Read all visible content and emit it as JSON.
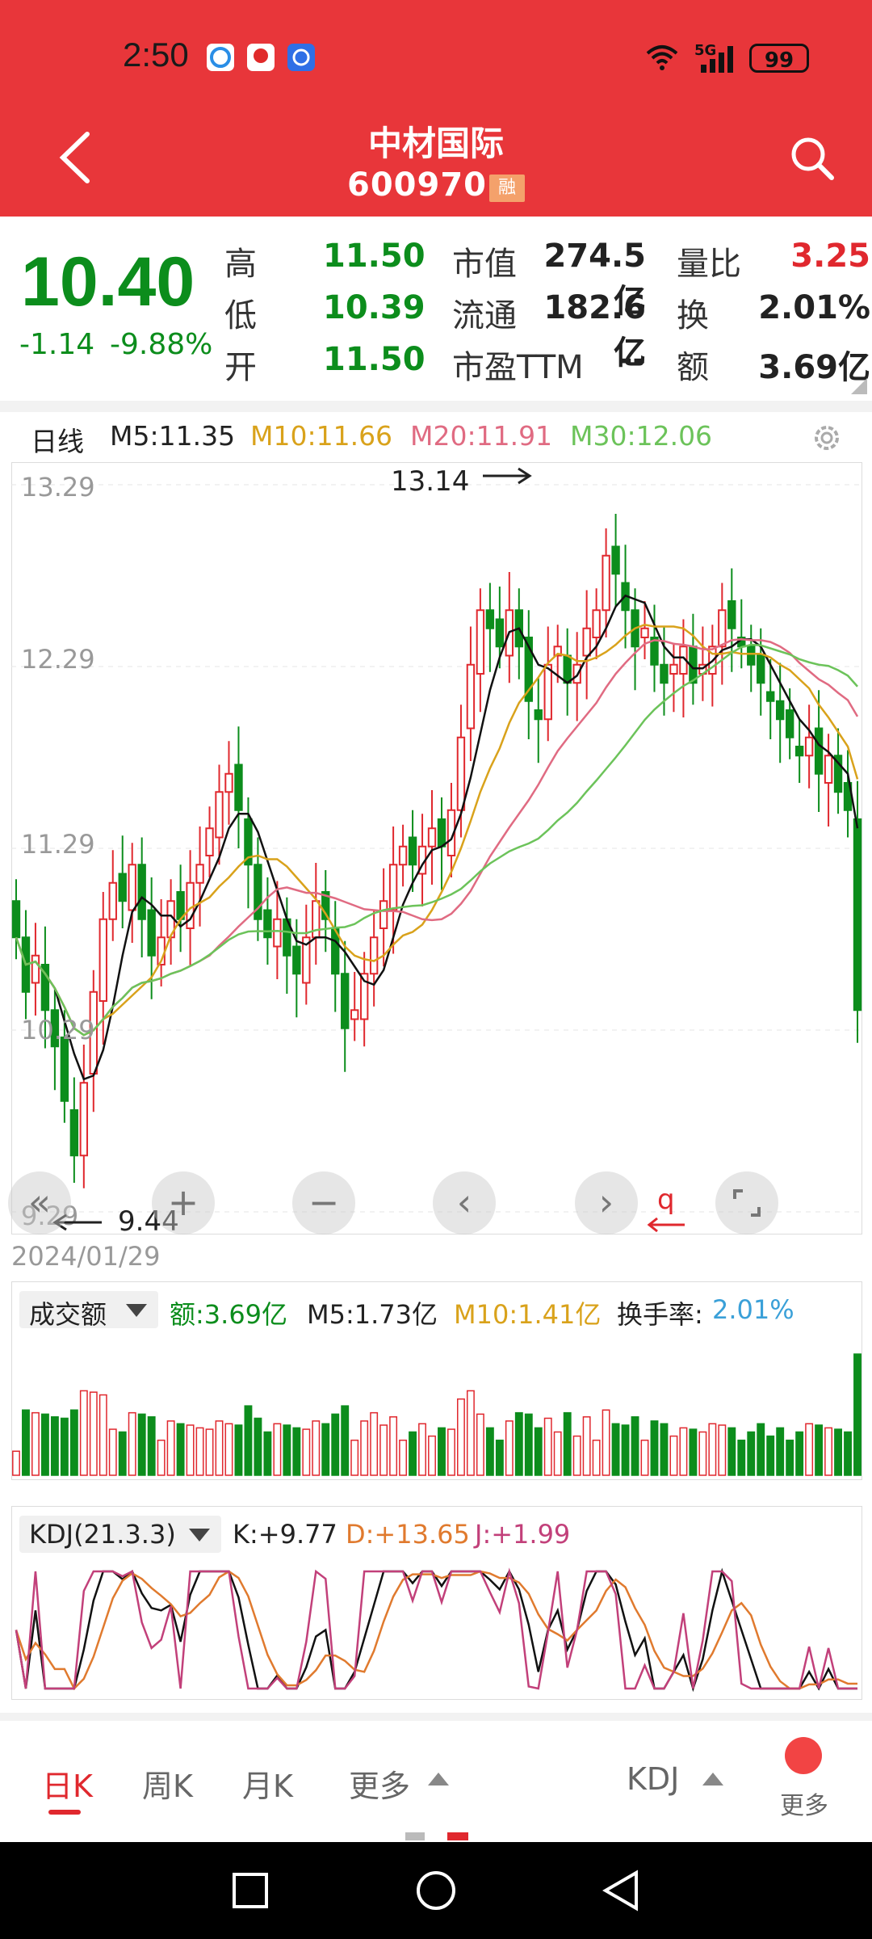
{
  "status": {
    "time": "2:50",
    "battery": "99",
    "network": "5G"
  },
  "header": {
    "name": "中材国际",
    "code": "600970",
    "badge": "融"
  },
  "quote": {
    "price": "10.40",
    "change": "-1.14",
    "change_pct": "-9.88%",
    "rows": [
      {
        "l1": "高",
        "v1": "11.50",
        "l2": "市值",
        "v2": "274.5亿",
        "l3": "量比",
        "v3": "3.25"
      },
      {
        "l1": "低",
        "v1": "10.39",
        "l2": "流通",
        "v2": "182.6亿",
        "l3": "换",
        "v3": "2.01%"
      },
      {
        "l1": "开",
        "v1": "11.50",
        "l2": "市盈TTM",
        "v2": "--",
        "l3": "额",
        "v3": "3.69亿"
      }
    ]
  },
  "ma_bar": {
    "period": "日线",
    "m5": "M5:11.35",
    "m10": "M10:11.66",
    "m20": "M20:11.91",
    "m30": "M30:12.06"
  },
  "colors": {
    "red": "#e0282e",
    "green": "#0c8d1c",
    "m10": "#d9a21b",
    "m20": "#e06b82",
    "m30": "#6cc35a",
    "header": "#e8363a"
  },
  "kline": {
    "y_labels": [
      "13.29",
      "12.29",
      "11.29",
      "10.29",
      "9.29"
    ],
    "high_marker": "13.14",
    "low_marker": "9.44",
    "date": "2024/01/29"
  },
  "volume": {
    "selector": "成交额",
    "amount": "额:3.69亿",
    "m5": "M5:1.73亿",
    "m10": "M10:1.41亿",
    "turnover_label": "换手率:",
    "turnover": "2.01%"
  },
  "kdj": {
    "selector": "KDJ(21.3.3)",
    "k": "K:+9.77",
    "d": "D:+13.65",
    "j": "J:+1.99"
  },
  "chart_data": {
    "type": "candlestick",
    "ylim": [
      9.29,
      13.29
    ],
    "y_ticks": [
      13.29,
      12.29,
      11.29,
      10.29,
      9.29
    ],
    "max_high": 13.14,
    "min_low": 9.44,
    "closes": [
      10.8,
      10.5,
      10.7,
      10.4,
      10.2,
      9.9,
      9.6,
      10.0,
      10.5,
      10.9,
      11.1,
      11.0,
      11.2,
      10.9,
      10.7,
      10.8,
      11.0,
      10.9,
      11.1,
      11.2,
      11.4,
      11.6,
      11.7,
      11.5,
      11.2,
      10.9,
      10.8,
      10.9,
      10.7,
      10.6,
      10.8,
      11.0,
      10.9,
      10.6,
      10.3,
      10.4,
      10.6,
      10.8,
      11.0,
      11.2,
      11.3,
      11.2,
      11.3,
      11.4,
      11.3,
      11.5,
      11.9,
      12.3,
      12.6,
      12.5,
      12.4,
      12.6,
      12.4,
      12.1,
      12.0,
      12.3,
      12.4,
      12.2,
      12.3,
      12.5,
      12.6,
      12.9,
      12.8,
      12.6,
      12.4,
      12.5,
      12.3,
      12.2,
      12.3,
      12.4,
      12.2,
      12.3,
      12.4,
      12.6,
      12.5,
      12.4,
      12.3,
      12.2,
      12.1,
      12.0,
      11.9,
      11.8,
      11.9,
      11.7,
      11.8,
      11.6,
      11.5,
      10.4
    ]
  }
}
